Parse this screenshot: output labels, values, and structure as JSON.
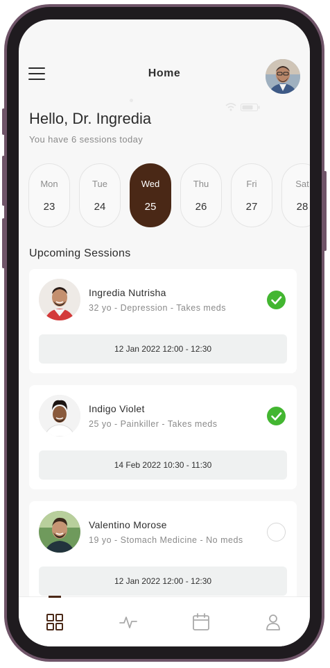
{
  "header": {
    "title": "Home"
  },
  "greeting": {
    "title": "Hello, Dr. Ingredia",
    "subtitle": "You have 6 sessions today"
  },
  "days": [
    {
      "name": "Mon",
      "date": "23",
      "active": false
    },
    {
      "name": "Tue",
      "date": "24",
      "active": false
    },
    {
      "name": "Wed",
      "date": "25",
      "active": true
    },
    {
      "name": "Thu",
      "date": "26",
      "active": false
    },
    {
      "name": "Fri",
      "date": "27",
      "active": false
    },
    {
      "name": "Sat",
      "date": "28",
      "active": false
    }
  ],
  "sessions_title": "Upcoming Sessions",
  "sessions": [
    {
      "name": "Ingredia Nutrisha",
      "info": "32 yo - Depression - Takes meds",
      "time": "12 Jan 2022 12:00 - 12:30",
      "checked": true
    },
    {
      "name": "Indigo Violet",
      "info": "25 yo - Painkiller - Takes meds",
      "time": "14 Feb 2022 10:30 - 11:30",
      "checked": true
    },
    {
      "name": "Valentino Morose",
      "info": "19 yo - Stomach Medicine - No meds",
      "time": "12 Jan 2022 12:00 - 12:30",
      "checked": false
    }
  ],
  "tabs": [
    {
      "icon": "dashboard-grid-icon",
      "active": true
    },
    {
      "icon": "activity-pulse-icon",
      "active": false
    },
    {
      "icon": "calendar-icon",
      "active": false
    },
    {
      "icon": "profile-user-icon",
      "active": false
    }
  ],
  "colors": {
    "accent": "#4a2816",
    "check": "#43b631",
    "frame": "#6f5468"
  }
}
